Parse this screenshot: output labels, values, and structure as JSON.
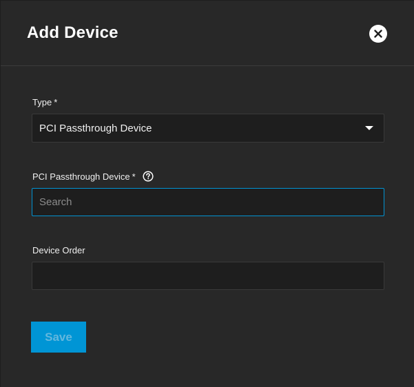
{
  "dialog": {
    "title": "Add Device",
    "close_icon": "close-circle-icon"
  },
  "form": {
    "type": {
      "label": "Type",
      "required_mark": "*",
      "selected_value": "PCI Passthrough Device"
    },
    "pci_device": {
      "label": "PCI Passthrough Device",
      "required_mark": "*",
      "help_icon": "question-circle-icon",
      "placeholder": "Search",
      "value": ""
    },
    "device_order": {
      "label": "Device Order",
      "value": ""
    }
  },
  "actions": {
    "save_label": "Save",
    "save_disabled": true
  },
  "colors": {
    "background": "#282828",
    "field_background": "#1e1e1e",
    "accent": "#0095d5"
  }
}
